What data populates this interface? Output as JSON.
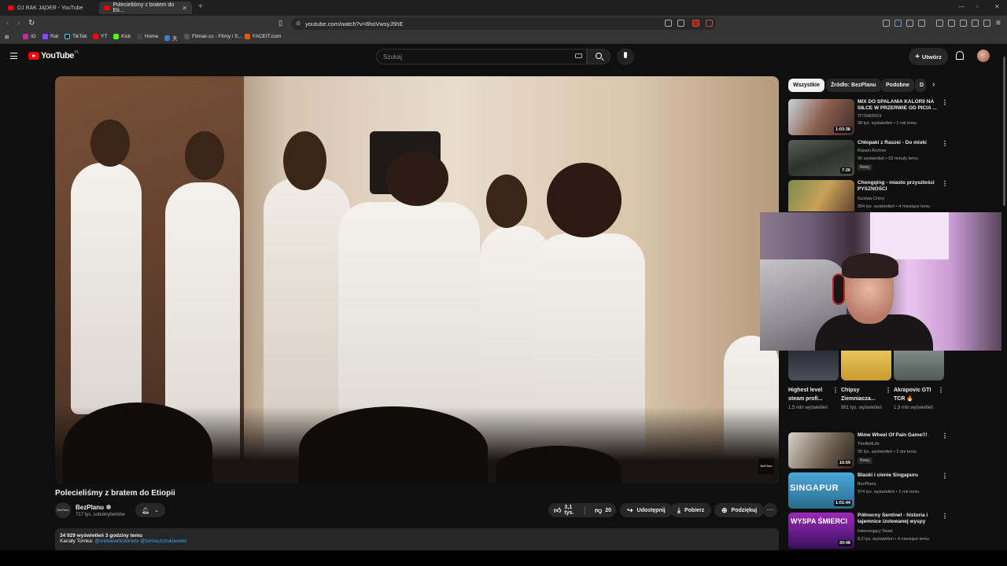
{
  "browser": {
    "tabs": [
      {
        "title": "DJ RAK JĄDER - YouTube"
      },
      {
        "title": "Polecieliśmy z bratem do Eti..."
      }
    ],
    "url": "youtube.com/watch?v=8hoVwsyJ5hE",
    "bookmarks": [
      "IG",
      "Rat",
      "TikTok",
      "YT",
      "Kick",
      "Home",
      "天",
      "Filman.cc - Filmy i S...",
      "FACEIT.com"
    ]
  },
  "youtube": {
    "logo": "YouTube",
    "country": "PL",
    "search_placeholder": "Szukaj",
    "create_label": "Utwórz"
  },
  "video": {
    "title": "Polecieliśmy z bratem do Etiopii",
    "watermark": "BezPlanu",
    "channel": {
      "avatar_text": "BezPlanu",
      "name": "BezPlanu",
      "subscribers": "717 tys. subskrybentów"
    },
    "actions": {
      "likes": "3,1 tys.",
      "dislikes": "20",
      "share": "Udostępnij",
      "download": "Pobierz",
      "thanks": "Podziękuj"
    },
    "description": {
      "stats": "34 929 wyświetleń  3 godziny temu",
      "channels_label": "Kanały Tomka:",
      "channels_links": "@ciekawehistorietv @tomaszczukiewski"
    }
  },
  "sidebar": {
    "chips": [
      "Wszystkie",
      "Źródło: BezPlanu",
      "Podobne",
      "D"
    ],
    "items_top": [
      {
        "title": "MIX DO SPALANIA KALORII NA SIŁCE W PRZERWIE OD PICIA ...",
        "channel": "TiTSMON19",
        "meta": "38 tys. wyświetleń • 1 rok temu",
        "duration": "1:03:38",
        "badge": ""
      },
      {
        "title": "Chłopaki z Raszei - Do miski",
        "channel": "Raszei Archive",
        "meta": "96 wyświetleń • 53 minuty temu",
        "duration": "7:26",
        "badge": "Nowy"
      },
      {
        "title": "Chongqing - miasto przyszłości PYSZNOŚCI",
        "channel": "Gustaw Chiny",
        "meta": "304 tys. wyświetleń • 4 miesiące temu",
        "duration": "",
        "badge": ""
      }
    ],
    "shorts": [
      {
        "title": "Highest level steam profi...",
        "views": "1,5 mln wyświetleń"
      },
      {
        "title": "Chipsy Ziemniacza...",
        "views": "981 tys. wyświetleń"
      },
      {
        "title": "Akrapovic GTI TCR 🔥",
        "views": "1,3 mln wyświetleń"
      }
    ],
    "items_bottom": [
      {
        "title": "Mime Wheel Of Pain Game!!!",
        "channel": "TheBeltLife",
        "meta": "35 tys. wyświetleń • 3 dni temu",
        "duration": "16:59",
        "badge": "Nowy"
      },
      {
        "title": "Blaski i cienie Singapuru",
        "channel": "BezPlanu",
        "meta": "974 tys. wyświetleń • 1 rok temu",
        "duration": "1:01:44",
        "badge": "",
        "thumb_text": "SINGAPUR"
      },
      {
        "title": "Północny Sentinel - historia i tajemnice izolowanej wyspy",
        "channel": "Interesujący Świat",
        "meta": "8,2 tys. wyświetleń • 4 miesiące temu",
        "duration": "30:48",
        "badge": "",
        "thumb_text": "WYSPA ŚMIERCI"
      }
    ]
  }
}
